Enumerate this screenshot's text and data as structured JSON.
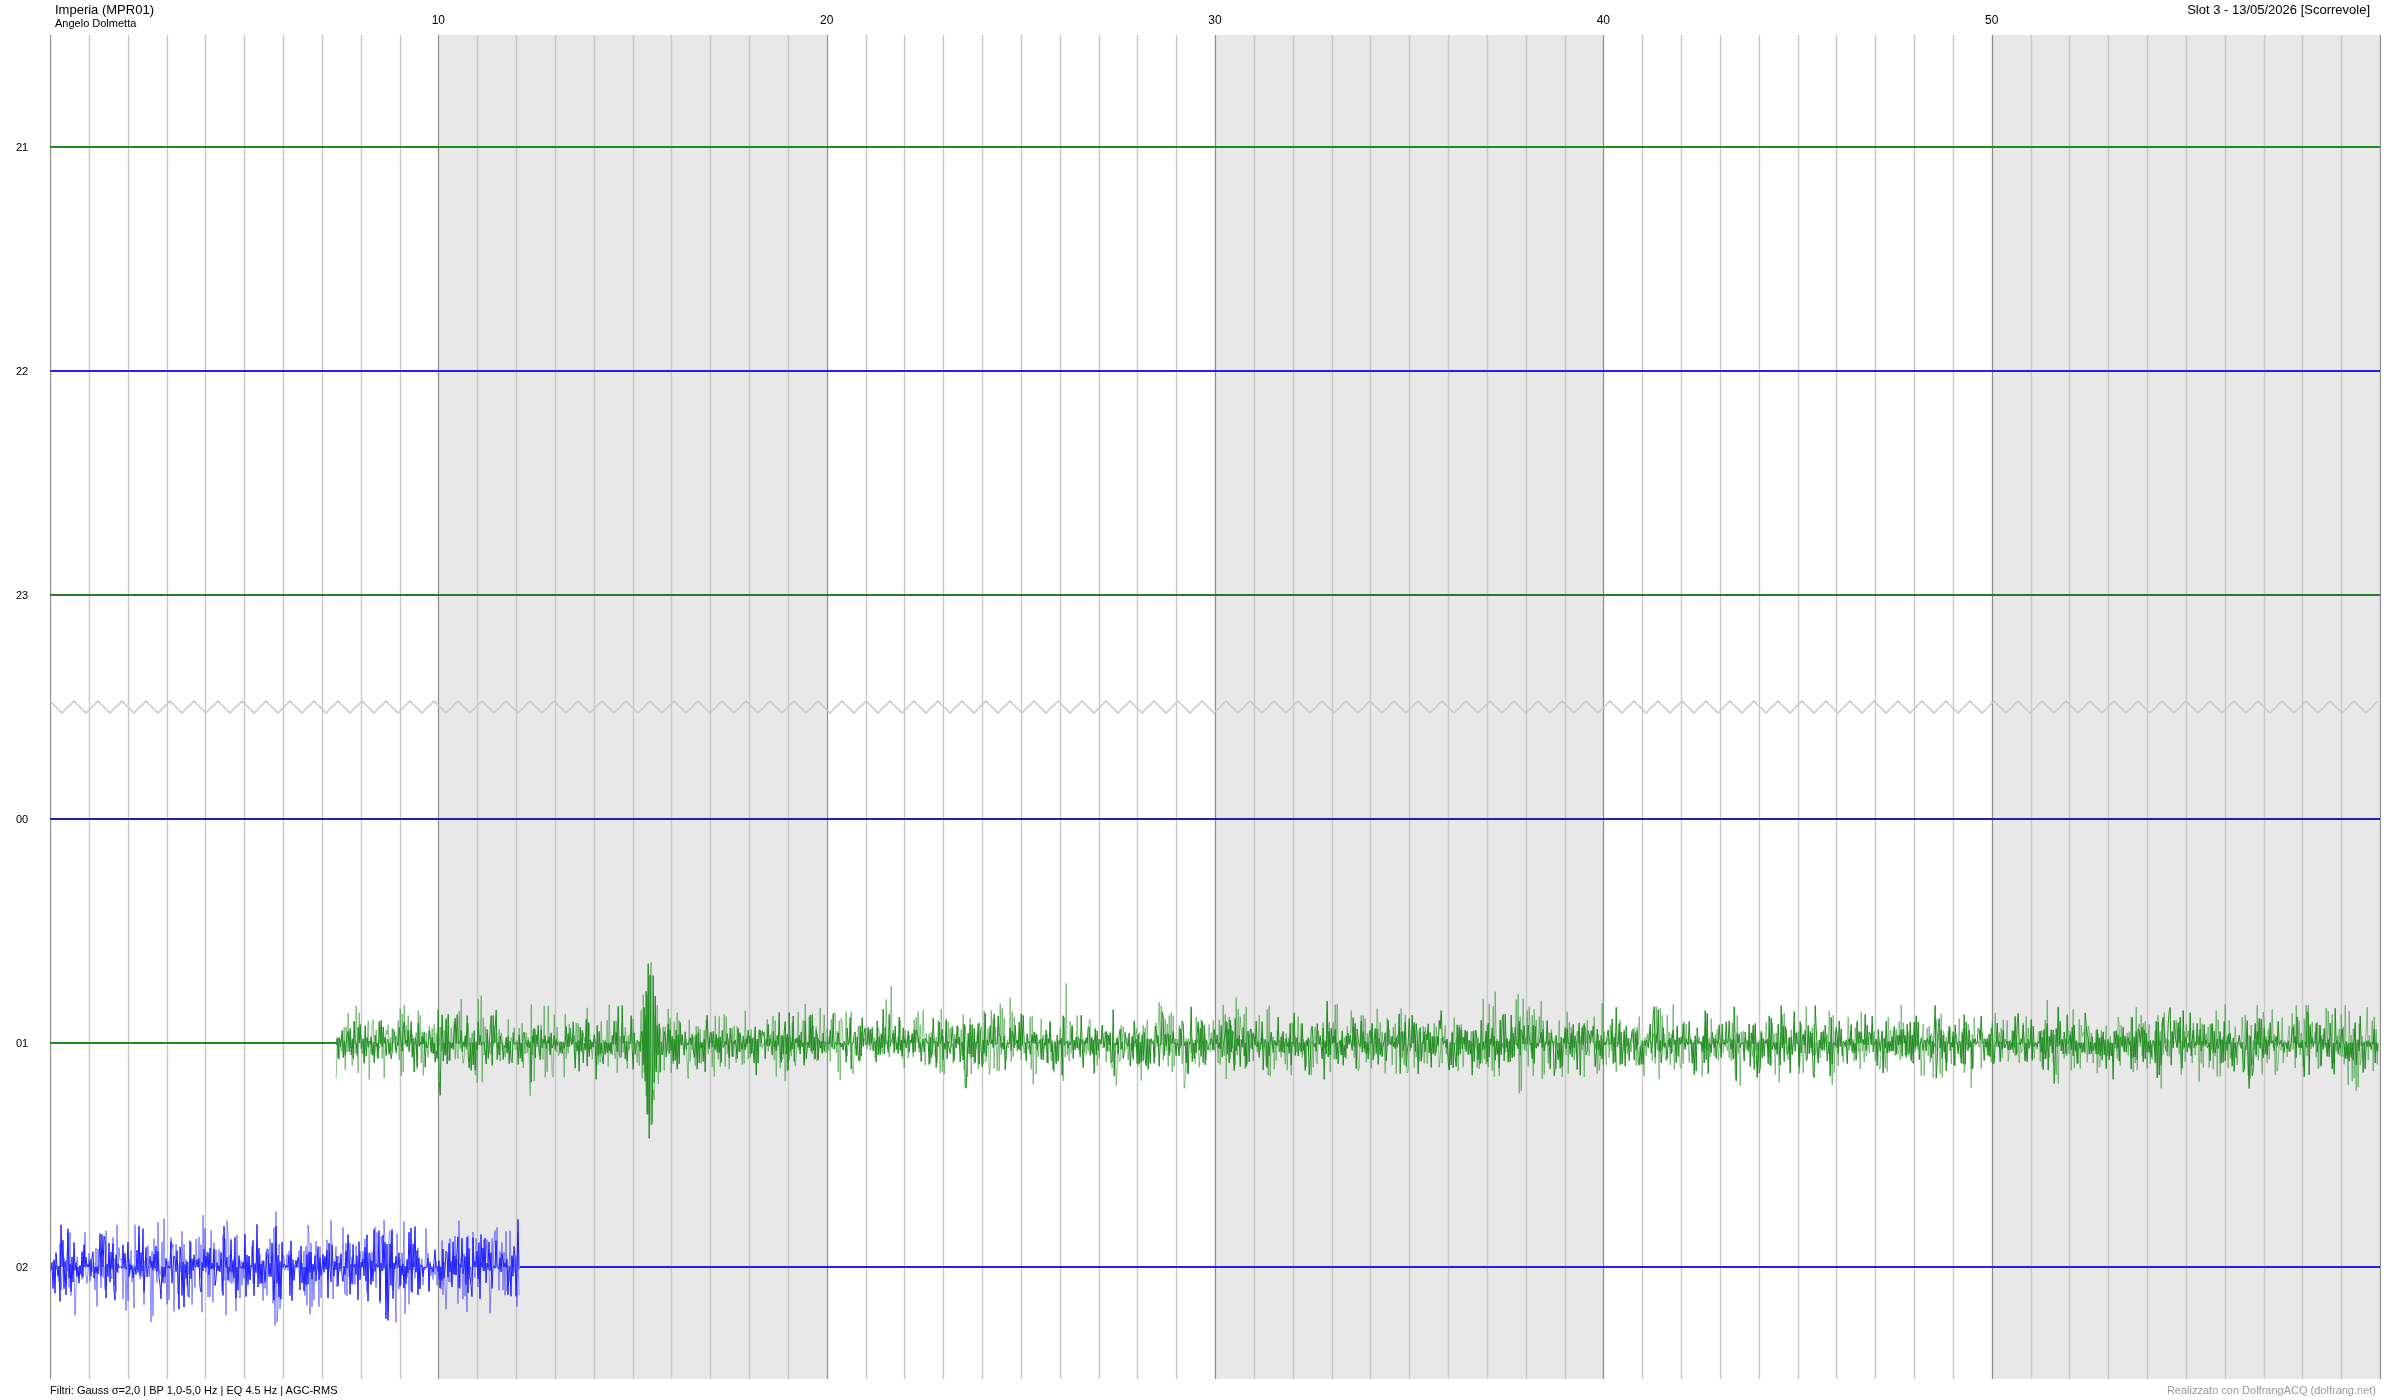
{
  "header": {
    "station": "Imperia (MPR01)",
    "operator": "Angelo Dolmetta",
    "slot": "Slot 3 - 13/05/2026 [Scorrevole]"
  },
  "x_axis": {
    "ticks": [
      "10",
      "20",
      "30",
      "40",
      "50"
    ]
  },
  "rows": [
    {
      "label": "21",
      "kind": "idle",
      "color": "#1e8c1e"
    },
    {
      "label": "22",
      "kind": "idle",
      "color": "#1f1fff"
    },
    {
      "label": "23",
      "kind": "idle",
      "color": "#2a7a2a"
    },
    {
      "kind": "break"
    },
    {
      "label": "00",
      "kind": "idle",
      "color": "#1f1fbf"
    },
    {
      "label": "01",
      "kind": "onset",
      "color": "#1e8c1e"
    },
    {
      "label": "02",
      "kind": "ending",
      "color": "#1f1fff"
    }
  ],
  "footer": {
    "filters": "Filtri: Gauss σ=2,0 | BP 1,0-5,0 Hz | EQ 4.5 Hz | AGC-RMS",
    "credit": "Realizzato con DolfrangACQ (dolfrang.net)"
  }
}
